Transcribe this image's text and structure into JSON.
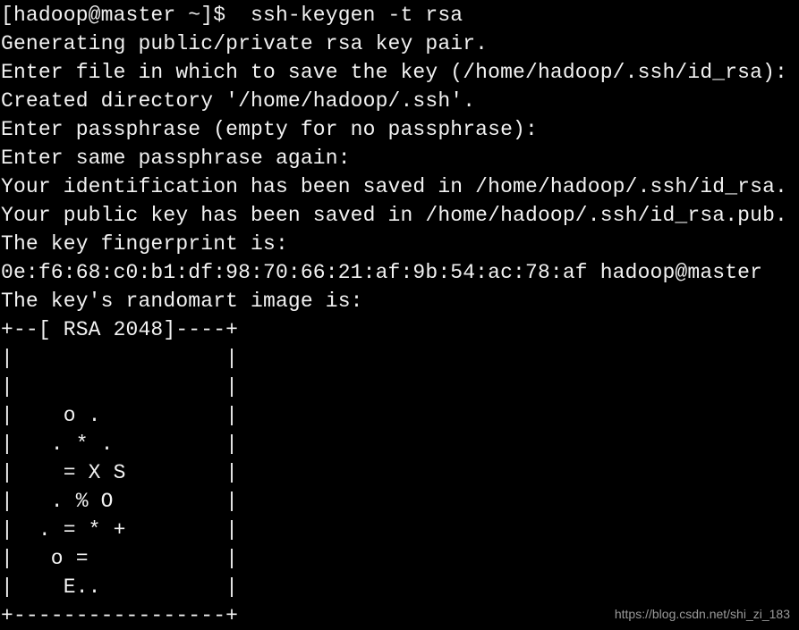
{
  "terminal": {
    "background": "#000000",
    "foreground": "#f2f2f2",
    "lines": [
      "[hadoop@master ~]$  ssh-keygen -t rsa",
      "Generating public/private rsa key pair.",
      "Enter file in which to save the key (/home/hadoop/.ssh/id_rsa):",
      "Created directory '/home/hadoop/.ssh'.",
      "Enter passphrase (empty for no passphrase):",
      "Enter same passphrase again:",
      "Your identification has been saved in /home/hadoop/.ssh/id_rsa.",
      "Your public key has been saved in /home/hadoop/.ssh/id_rsa.pub.",
      "The key fingerprint is:",
      "0e:f6:68:c0:b1:df:98:70:66:21:af:9b:54:ac:78:af hadoop@master",
      "The key's randomart image is:",
      "+--[ RSA 2048]----+",
      "|                 |",
      "|                 |",
      "|    o .          |",
      "|   . * .         |",
      "|    = X S        |",
      "|   . % O         |",
      "|  . = * +        |",
      "|   o =           |",
      "|    E..          |",
      "+-----------------+"
    ]
  },
  "watermark": "https://blog.csdn.net/shi_zi_183"
}
